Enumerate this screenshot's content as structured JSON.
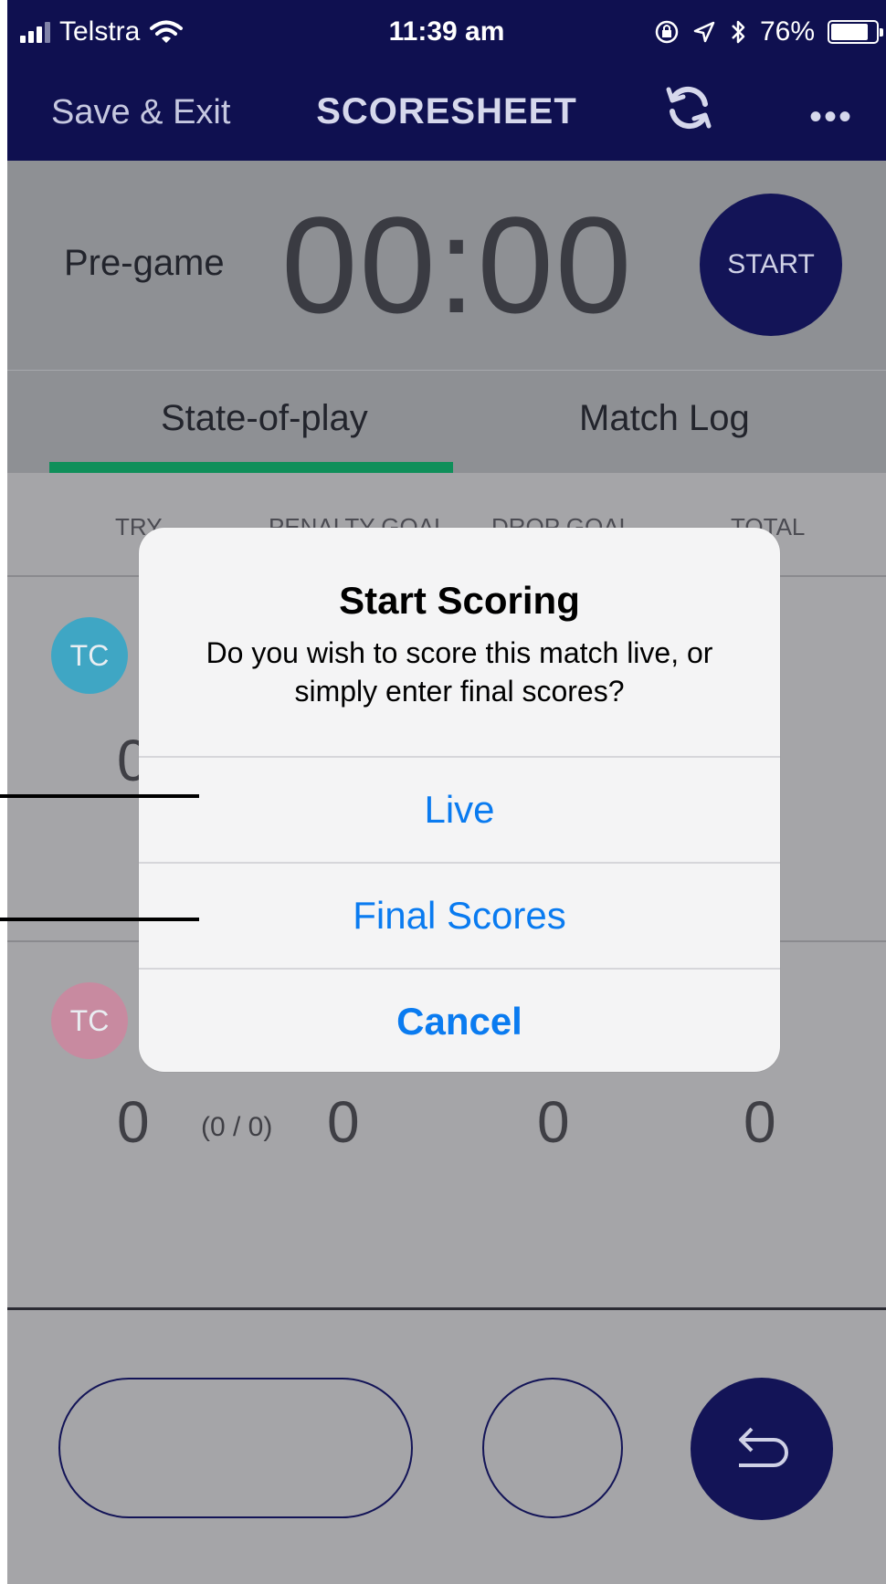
{
  "status_bar": {
    "carrier": "Telstra",
    "time": "11:39 am",
    "battery": "76%",
    "battery_level": 0.76
  },
  "nav": {
    "save_exit": "Save & Exit",
    "title": "SCORESHEET",
    "more": "•••"
  },
  "timer": {
    "phase": "Pre-game",
    "clock": "00:00",
    "start": "START"
  },
  "tabs": {
    "state_of_play": "State-of-play",
    "match_log": "Match Log"
  },
  "columns": {
    "try": "TRY",
    "penalty_goal": "PENALTY GOAL",
    "drop_goal": "DROP GOAL",
    "total": "TOTAL"
  },
  "teams": [
    {
      "initials": "TC",
      "color": "#3fa6c4",
      "try": "0"
    },
    {
      "initials": "TC",
      "color": "#c88aa0",
      "try": "0",
      "conversions": "(0 / 0)",
      "penalty_goal": "0",
      "drop_goal": "0",
      "total": "0"
    }
  ],
  "dialog": {
    "title": "Start Scoring",
    "message": "Do you wish to score this match live, or simply enter final scores?",
    "live": "Live",
    "final_scores": "Final Scores",
    "cancel": "Cancel"
  },
  "colors": {
    "navy": "#0f1050",
    "accent_green": "#0f8f5a",
    "ios_blue": "#0a7bf0"
  }
}
